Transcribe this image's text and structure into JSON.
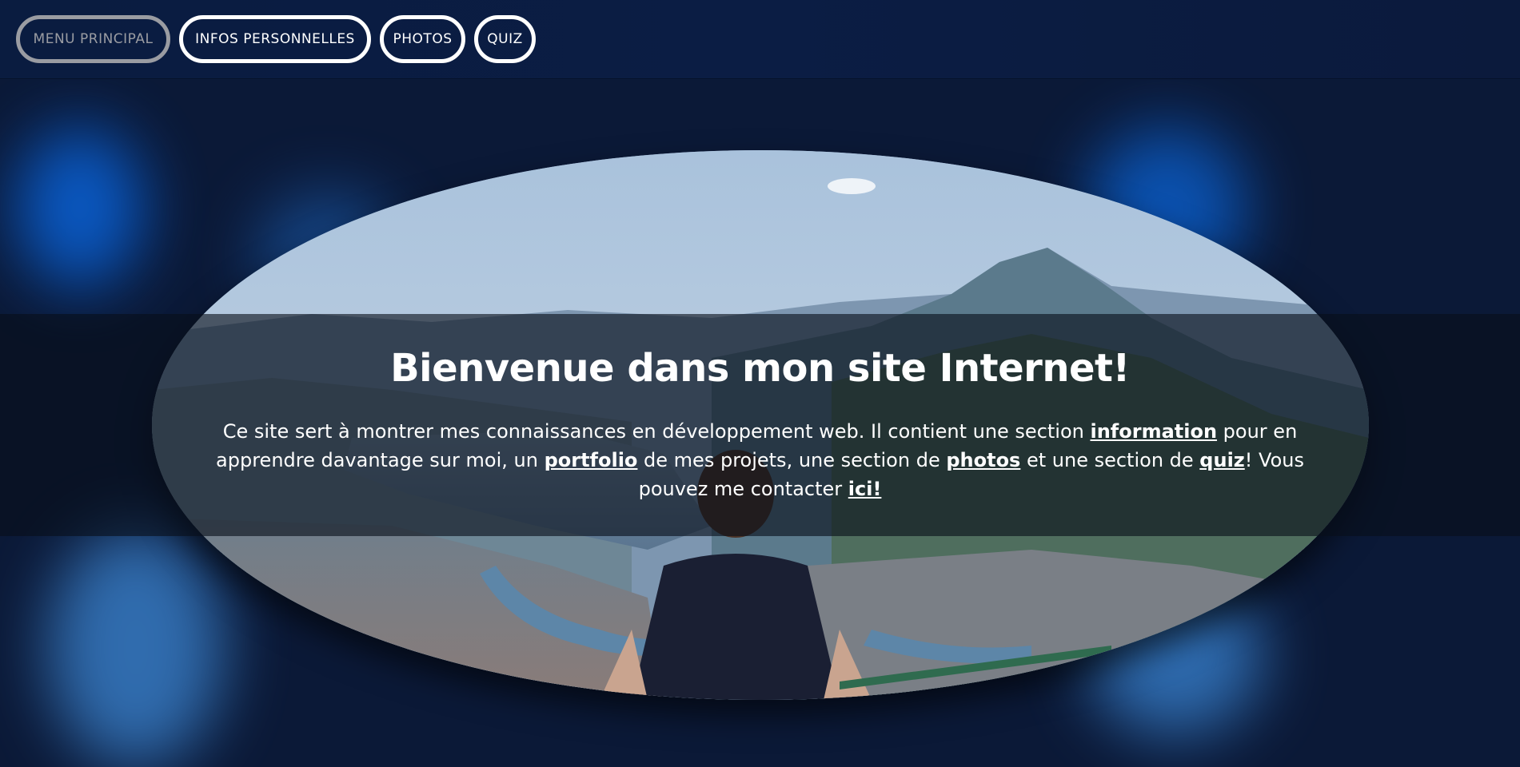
{
  "nav": {
    "items": [
      {
        "label": "MENU PRINCIPAL",
        "active": true
      },
      {
        "label": "INFOS PERSONNELLES",
        "active": false
      },
      {
        "label": "PHOTOS",
        "active": false
      },
      {
        "label": "QUIZ",
        "active": false
      }
    ]
  },
  "hero": {
    "title": "Bienvenue dans mon site Internet!",
    "text": {
      "part1": "Ce site sert à montrer mes connaissances en développement web. Il contient une section ",
      "link_information": "information",
      "part2": " pour en apprendre davantage sur moi, un ",
      "link_portfolio": "portfolio",
      "part3": " de mes projets, une section de ",
      "link_photos": "photos",
      "part4": " et une section de ",
      "link_quiz": "quiz",
      "part5": "! Vous pouvez me contacter ",
      "link_ici": "ici!"
    }
  },
  "colors": {
    "background": "#0b1a3a",
    "nav_background": "#0a1c40",
    "active_button": "#9a9ca2",
    "button_border": "#ffffff"
  }
}
